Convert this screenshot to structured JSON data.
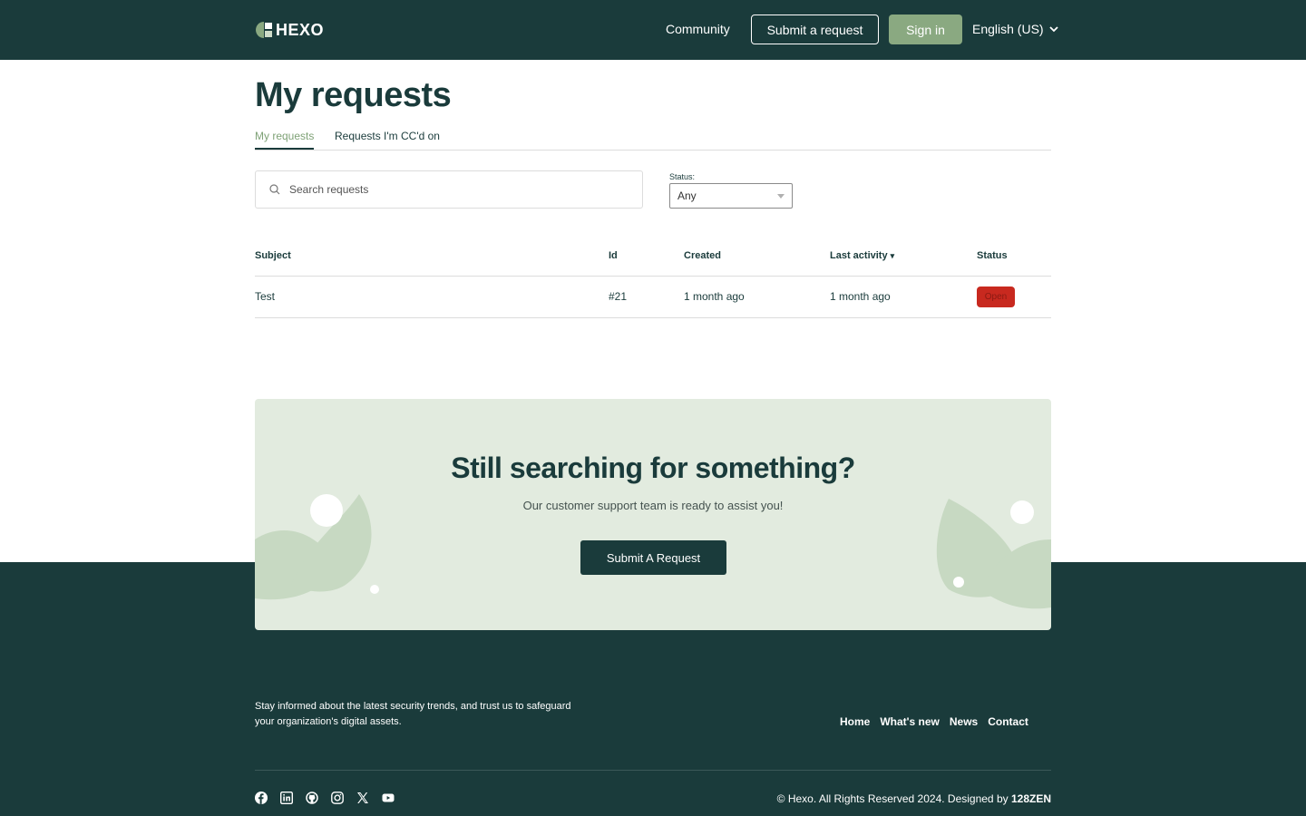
{
  "header": {
    "brand": "HEXO",
    "nav_community": "Community",
    "submit_request": "Submit a request",
    "sign_in": "Sign in",
    "language": "English (US)"
  },
  "page": {
    "title": "My requests",
    "tabs": [
      {
        "label": "My requests",
        "active": true
      },
      {
        "label": "Requests I'm CC'd on",
        "active": false
      }
    ]
  },
  "filters": {
    "search_placeholder": "Search requests",
    "status_label": "Status:",
    "status_value": "Any"
  },
  "table": {
    "columns": [
      "Subject",
      "Id",
      "Created",
      "Last activity",
      "Status"
    ],
    "sort_indicator": "▾",
    "rows": [
      {
        "subject": "Test",
        "id": "#21",
        "created": "1 month ago",
        "last_activity": "1 month ago",
        "status": "Open"
      }
    ]
  },
  "cta": {
    "title": "Still searching for something?",
    "subtitle": "Our customer support team is ready to assist you!",
    "button": "Submit A Request"
  },
  "footer": {
    "tagline": "Stay informed about the latest security trends, and trust us to safeguard your organization's digital assets.",
    "links": [
      "Home",
      "What's new",
      "News",
      "Contact"
    ],
    "social_icons": [
      "facebook-icon",
      "linkedin-icon",
      "github-icon",
      "instagram-icon",
      "x-icon",
      "youtube-icon"
    ],
    "copyright_prefix": "© Hexo. All Rights Reserved 2024. Designed by",
    "designer": "128ZEN"
  },
  "colors": {
    "primary_dark": "#1a3b3b",
    "accent_green": "#8aa981",
    "cta_bg": "#e2ebdf",
    "status_open": "#c8291f"
  }
}
